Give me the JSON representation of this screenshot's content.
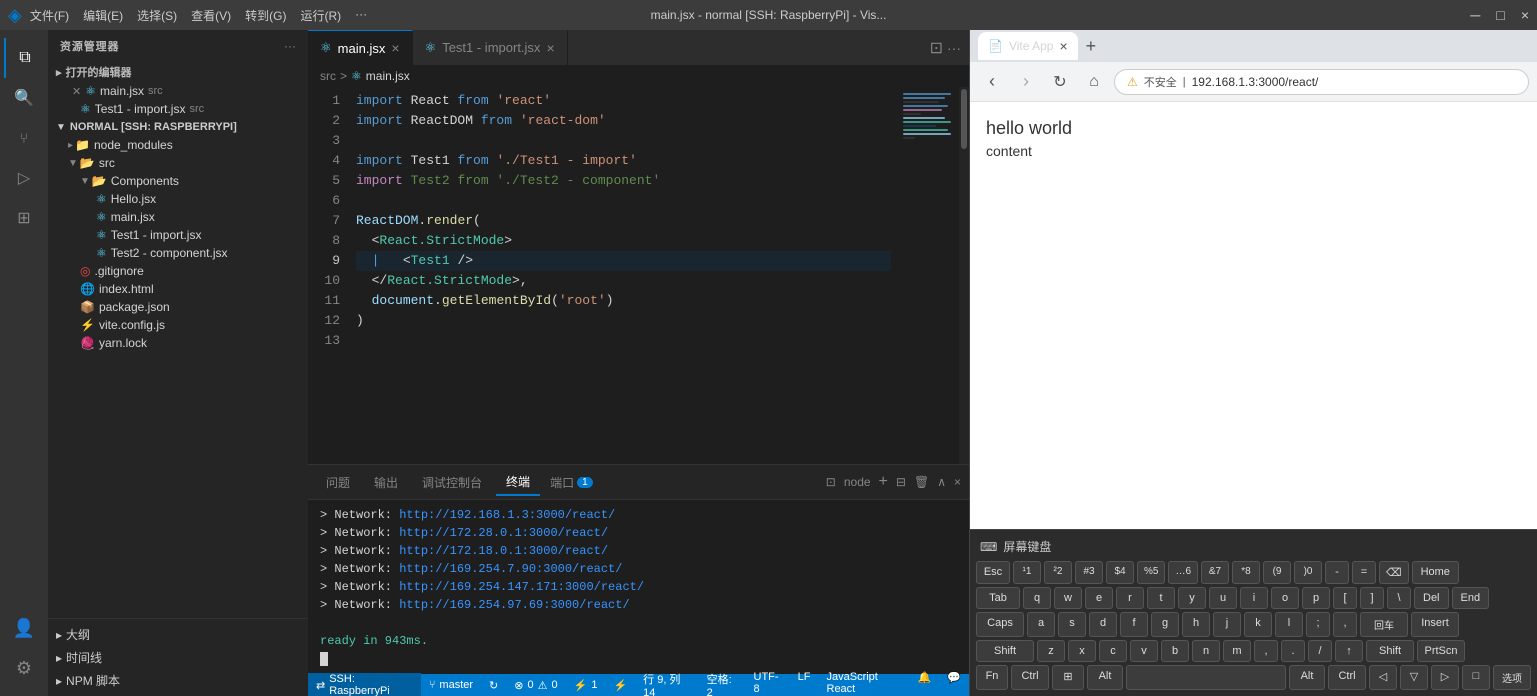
{
  "titlebar": {
    "icon": "◈",
    "menus": [
      "文件(F)",
      "编辑(E)",
      "选择(S)",
      "查看(V)",
      "转到(G)",
      "运行(R)",
      "···"
    ],
    "title": "main.jsx - normal [SSH: RaspberryPi] - Vis...",
    "controls": [
      "─",
      "□",
      "×"
    ]
  },
  "activity_bar": {
    "items": [
      {
        "name": "explorer-icon",
        "icon": "⧉",
        "active": true
      },
      {
        "name": "search-icon",
        "icon": "🔍",
        "active": false
      },
      {
        "name": "source-control-icon",
        "icon": "⑂",
        "active": false
      },
      {
        "name": "run-debug-icon",
        "icon": "▷",
        "active": false
      },
      {
        "name": "extensions-icon",
        "icon": "⊞",
        "active": false
      }
    ],
    "bottom": [
      {
        "name": "account-icon",
        "icon": "👤"
      },
      {
        "name": "settings-icon",
        "icon": "⚙"
      }
    ]
  },
  "sidebar": {
    "title": "资源管理器",
    "more_icon": "···",
    "sections": {
      "open_editors": {
        "label": "▸ 打开的编辑器",
        "files": [
          {
            "name": "main.jsx",
            "suffix": "src",
            "icon": "⚛",
            "icon_color": "#61dafb",
            "closable": true
          },
          {
            "name": "Test1 - import.jsx",
            "suffix": "src",
            "icon": "⚛",
            "icon_color": "#61dafb",
            "closable": false
          }
        ]
      },
      "explorer": {
        "label": "NORMAL [SSH: RASPBERRYPI]",
        "items": [
          {
            "type": "folder",
            "name": "node_modules",
            "indent": 1,
            "collapsed": true
          },
          {
            "type": "folder",
            "name": "src",
            "indent": 1,
            "collapsed": false
          },
          {
            "type": "folder",
            "name": "Components",
            "indent": 2,
            "collapsed": false
          },
          {
            "type": "file",
            "name": "Hello.jsx",
            "indent": 3,
            "icon": "⚛",
            "icon_color": "#61dafb"
          },
          {
            "type": "file",
            "name": "main.jsx",
            "indent": 3,
            "icon": "⚛",
            "icon_color": "#61dafb"
          },
          {
            "type": "file",
            "name": "Test1 - import.jsx",
            "indent": 3,
            "icon": "⚛",
            "icon_color": "#61dafb"
          },
          {
            "type": "file",
            "name": "Test2 - component.jsx",
            "indent": 3,
            "icon": "⚛",
            "icon_color": "#61dafb"
          },
          {
            "type": "file",
            "name": ".gitignore",
            "indent": 2,
            "icon": "◎",
            "icon_color": "#f44747"
          },
          {
            "type": "file",
            "name": "index.html",
            "indent": 2,
            "icon": "🌐",
            "icon_color": "#e34c26"
          },
          {
            "type": "file",
            "name": "package.json",
            "indent": 2,
            "icon": "📦",
            "icon_color": "#cbcb41"
          },
          {
            "type": "file",
            "name": "vite.config.js",
            "indent": 2,
            "icon": "⚡",
            "icon_color": "#f0db4f"
          },
          {
            "type": "file",
            "name": "yarn.lock",
            "indent": 2,
            "icon": "🧶",
            "icon_color": "#2c8ebb"
          }
        ]
      }
    },
    "footer": {
      "items": [
        "大纲",
        "时间线",
        "NPM 脚本"
      ]
    }
  },
  "tabs": {
    "items": [
      {
        "label": "main.jsx",
        "icon": "⚛",
        "active": true,
        "closable": true
      },
      {
        "label": "Test1 - import.jsx",
        "icon": "⚛",
        "active": false,
        "closable": true
      }
    ]
  },
  "breadcrumb": {
    "path": [
      "src",
      ">",
      "⚛ main.jsx"
    ]
  },
  "code": {
    "lines": [
      {
        "num": 1,
        "tokens": [
          {
            "t": "import",
            "c": "kw"
          },
          {
            "t": " React ",
            "c": ""
          },
          {
            "t": "from",
            "c": "kw"
          },
          {
            "t": " ",
            "c": ""
          },
          {
            "t": "'react'",
            "c": "str"
          }
        ]
      },
      {
        "num": 2,
        "tokens": [
          {
            "t": "import",
            "c": "kw"
          },
          {
            "t": " ReactDOM ",
            "c": ""
          },
          {
            "t": "from",
            "c": "kw"
          },
          {
            "t": " ",
            "c": ""
          },
          {
            "t": "'react-dom'",
            "c": "str"
          }
        ]
      },
      {
        "num": 3,
        "tokens": []
      },
      {
        "num": 4,
        "tokens": [
          {
            "t": "import",
            "c": "kw"
          },
          {
            "t": " Test1 ",
            "c": ""
          },
          {
            "t": "from",
            "c": "kw"
          },
          {
            "t": " ",
            "c": ""
          },
          {
            "t": "'./Test1 - import'",
            "c": "str"
          }
        ]
      },
      {
        "num": 5,
        "tokens": [
          {
            "t": "import",
            "c": "kw2"
          },
          {
            "t": " Test2 ",
            "c": "comment"
          },
          {
            "t": "from",
            "c": "comment"
          },
          {
            "t": " ",
            "c": ""
          },
          {
            "t": "'./Test2 - component'",
            "c": "comment"
          }
        ]
      },
      {
        "num": 6,
        "tokens": []
      },
      {
        "num": 7,
        "tokens": [
          {
            "t": "ReactDOM",
            "c": "var"
          },
          {
            "t": ".",
            "c": ""
          },
          {
            "t": "render",
            "c": "fn"
          },
          {
            "t": "(",
            "c": ""
          }
        ]
      },
      {
        "num": 8,
        "tokens": [
          {
            "t": "  <",
            "c": ""
          },
          {
            "t": "React.StrictMode",
            "c": "tag"
          },
          {
            "t": ">",
            "c": ""
          }
        ]
      },
      {
        "num": 9,
        "tokens": [
          {
            "t": "  | ",
            "c": "kw"
          },
          {
            "t": "  <",
            "c": ""
          },
          {
            "t": "Test1",
            "c": "tag"
          },
          {
            "t": " />",
            "c": ""
          }
        ]
      },
      {
        "num": 10,
        "tokens": [
          {
            "t": "  </",
            "c": ""
          },
          {
            "t": "React.StrictMode",
            "c": "tag"
          },
          {
            "t": ">,",
            "c": ""
          }
        ]
      },
      {
        "num": 11,
        "tokens": [
          {
            "t": "  document",
            "c": "var"
          },
          {
            "t": ".",
            "c": ""
          },
          {
            "t": "getElementById",
            "c": "fn"
          },
          {
            "t": "(",
            "c": ""
          },
          {
            "t": "'root'",
            "c": "str"
          },
          {
            "t": ")",
            "c": ""
          }
        ]
      },
      {
        "num": 12,
        "tokens": [
          {
            "t": ")",
            "c": ""
          }
        ]
      },
      {
        "num": 13,
        "tokens": []
      }
    ]
  },
  "panel": {
    "tabs": [
      "问题",
      "输出",
      "调试控制台",
      "终端",
      "端口"
    ],
    "active_tab": "终端",
    "terminal_badge": "1",
    "terminal_name": "node",
    "terminal_lines": [
      "> Network:  http://192.168.1.3:3000/react/",
      "> Network:  http://172.28.0.1:3000/react/",
      "> Network:  http://172.18.0.1:3000/react/",
      "> Network:  http://169.254.7.90:3000/react/",
      "> Network:  http://169.254.147.171:3000/react/",
      "> Network:  http://169.254.97.69:3000/react/"
    ],
    "ready_text": "ready in 943ms."
  },
  "statusbar": {
    "left": [
      {
        "icon": "⇄",
        "label": "SSH: RaspberryPi"
      },
      {
        "icon": "⑂",
        "label": "master"
      },
      {
        "icon": "↻",
        "label": ""
      },
      {
        "icon": "⊗",
        "label": "0"
      },
      {
        "icon": "⚠",
        "label": "0"
      },
      {
        "icon": "⚡",
        "label": "1"
      },
      {
        "icon": "⚡",
        "label": ""
      }
    ],
    "right": [
      {
        "label": "行 9, 列 14"
      },
      {
        "label": "空格: 2"
      },
      {
        "label": "UTF-8"
      },
      {
        "label": "LF"
      },
      {
        "label": "JavaScript React"
      },
      {
        "icon": "🔔"
      },
      {
        "icon": "💬"
      }
    ]
  },
  "browser": {
    "tab_title": "Vite App",
    "tab_icon": "📄",
    "url": "192.168.1.3:3000/react/",
    "protocol_warning": "不安全",
    "content_lines": [
      "hello world",
      "content"
    ]
  },
  "keyboard": {
    "title": "屏幕键盘",
    "rows": [
      [
        "Esc",
        "1",
        "2",
        "3",
        "4",
        "5",
        "6",
        "7",
        "8",
        "9",
        "0",
        "-",
        "=",
        "⌫",
        "Home"
      ],
      [
        "Tab",
        "q",
        "w",
        "e",
        "r",
        "t",
        "y",
        "u",
        "i",
        "o",
        "p",
        "[",
        "]",
        "\\",
        "Del",
        "End"
      ],
      [
        "Caps",
        "a",
        "s",
        "d",
        "f",
        "g",
        "h",
        "j",
        "k",
        "l",
        ";",
        ",",
        "回车",
        "Insert"
      ],
      [
        "Shift",
        "z",
        "x",
        "c",
        "v",
        "b",
        "n",
        "m",
        ",",
        ".",
        "/",
        "↑",
        "Shift",
        "PrtScn"
      ],
      [
        "Fn",
        "Ctrl",
        "⊞",
        "Alt",
        "Space",
        "Alt",
        "Ctrl",
        "◁",
        "▽",
        "▷",
        "□",
        "选项"
      ]
    ]
  }
}
